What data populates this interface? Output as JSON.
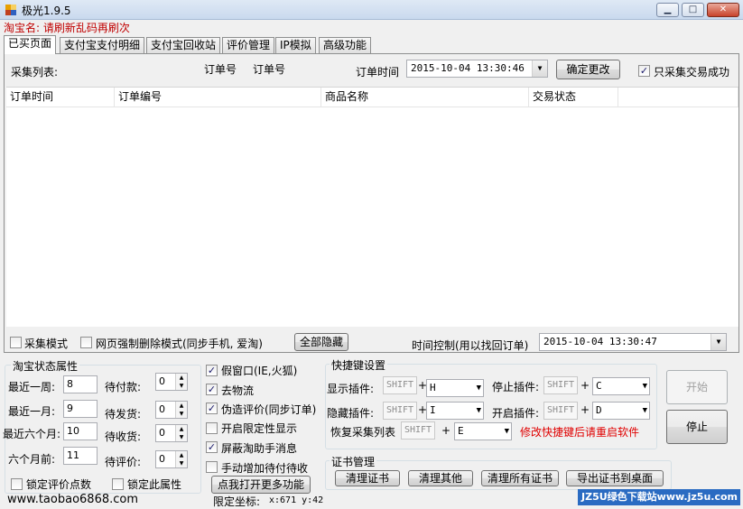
{
  "window": {
    "title": "极光1.9.5",
    "minimize": "▁",
    "maximize": "□",
    "close": "✕"
  },
  "taobao_name": {
    "label": "淘宝名:",
    "value": "请刷新乱码再刷次"
  },
  "tabs": [
    "已买页面",
    "支付宝支付明细",
    "支付宝回收站",
    "评价管理",
    "IP模拟",
    "高级功能"
  ],
  "panel": {
    "collect_list_label": "采集列表:",
    "order_no_label_1": "订单号",
    "order_no_label_2": "订单号",
    "order_time_label": "订单时间",
    "order_time_value": "2015-10-04 13:30:46",
    "confirm_button": "确定更改",
    "only_success_label": "只采集交易成功",
    "only_success_checked": true,
    "columns": [
      "订单时间",
      "订单编号",
      "商品名称",
      "交易状态"
    ],
    "collect_mode_label": "采集模式",
    "collect_mode_checked": false,
    "web_delete_label": "网页强制删除模式(同步手机, 爱淘)",
    "web_delete_checked": false,
    "hide_all_button": "全部隐藏",
    "time_control_label": "时间控制(用以找回订单)",
    "time_control_value": "2015-10-04 13:30:47"
  },
  "status_group": {
    "title": "淘宝状态属性",
    "rows": [
      {
        "label": "最近一周:",
        "value": "8",
        "right_label": "待付款:",
        "right_value": "0"
      },
      {
        "label": "最近一月:",
        "value": "9",
        "right_label": "待发货:",
        "right_value": "0"
      },
      {
        "label": "最近六个月:",
        "value": "10",
        "right_label": "待收货:",
        "right_value": "0"
      },
      {
        "label": "六个月前:",
        "value": "11",
        "right_label": "待评价:",
        "right_value": "0"
      }
    ],
    "lock_review_label": "锁定评价点数",
    "lock_attr_label": "锁定此属性"
  },
  "options": {
    "items": [
      {
        "label": "假窗口(IE,火狐)",
        "checked": true
      },
      {
        "label": "去物流",
        "checked": true
      },
      {
        "label": "伪造评价(同步订单)",
        "checked": true
      },
      {
        "label": "开启限定性显示",
        "checked": false
      },
      {
        "label": "屏蔽淘助手消息",
        "checked": true
      },
      {
        "label": "手动增加待付待收",
        "checked": false
      }
    ],
    "more_button": "点我打开更多功能"
  },
  "hotkeys": {
    "title": "快捷键设置",
    "show_plugin": "显示插件:",
    "stop_plugin": "停止插件:",
    "hide_plugin": "隐藏插件:",
    "start_plugin": "开启插件:",
    "restore_list": "恢复采集列表",
    "shift": "SHIFT",
    "plus": "+",
    "keys": {
      "show": "H",
      "stop": "C",
      "hide": "I",
      "start": "D",
      "restore": "E"
    },
    "warning": "修改快捷键后请重启软件",
    "start_button": "开始",
    "stop_button": "停止"
  },
  "cert": {
    "title": "证书管理",
    "buttons": [
      "清理证书",
      "清理其他",
      "清理所有证书",
      "导出证书到桌面"
    ]
  },
  "footer": {
    "site": "www.taobao6868.com",
    "coord_label": "限定坐标:",
    "coord_value": "x:671 y:42",
    "watermark": "JZ5U绿色下载站www.jz5u.com"
  }
}
